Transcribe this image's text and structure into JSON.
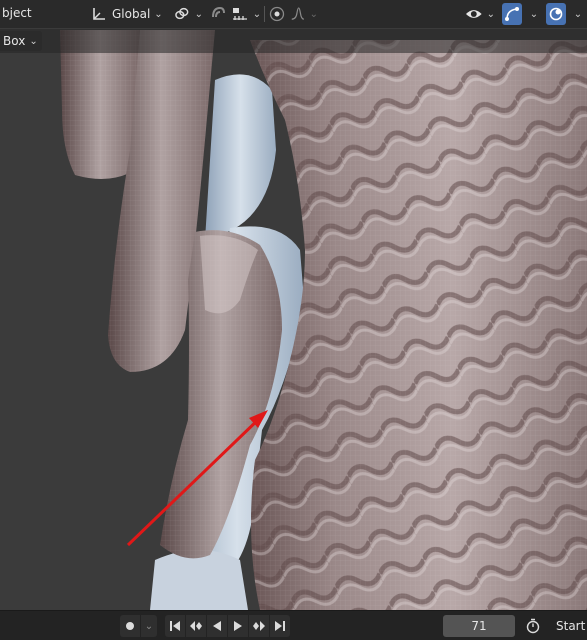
{
  "header": {
    "object_label": "bject",
    "transform_orientation": "Global",
    "icons": [
      "transform-pivot-icon",
      "link-icon",
      "snap-magnet-icon",
      "snap-increment-icon",
      "proportional-edit-icon",
      "falloff-curve-icon",
      "visibility-eye-icon",
      "gizmo-icon",
      "overlay-icon"
    ]
  },
  "subheader": {
    "select_mode": "Box"
  },
  "annotation": {
    "arrow_color": "#e01818"
  },
  "timeline": {
    "current_frame": "71",
    "start_label": "Start",
    "icons": [
      "record-icon",
      "jump-start-icon",
      "prev-keyframe-icon",
      "play-reverse-icon",
      "play-icon",
      "next-keyframe-icon",
      "jump-end-icon",
      "stopwatch-icon"
    ]
  },
  "colors": {
    "accent": "#4772b3",
    "header_bg": "#282828",
    "viewport_bg": "#3b3b3b"
  }
}
